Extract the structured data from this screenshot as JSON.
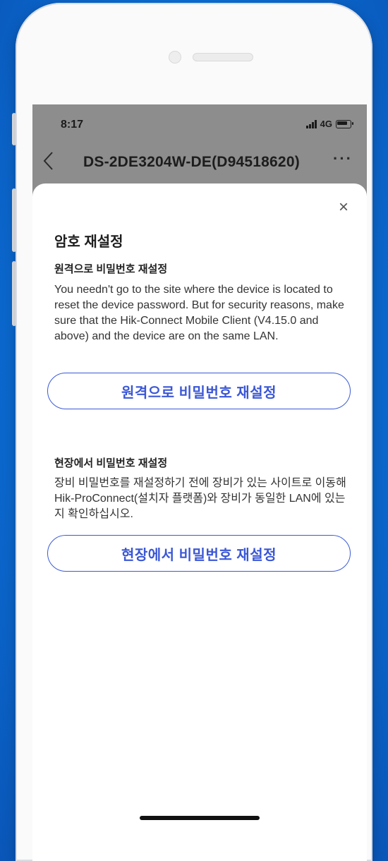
{
  "status_bar": {
    "time": "8:17",
    "network": "4G"
  },
  "nav": {
    "back_icon": "chevron-left-icon",
    "title": "DS-2DE3204W-DE(D94518620)",
    "more_icon": "more-dots-icon",
    "more_glyph": "···"
  },
  "sheet": {
    "close_glyph": "×",
    "title": "암호 재설정",
    "remote": {
      "heading": "원격으로 비밀번호 재설정",
      "description": "You needn't go to the site where the device is located to reset the device password. But for security reasons, make sure that the Hik-Connect Mobile Client (V4.15.0 and above) and the device are on the same LAN.",
      "button_label": "원격으로 비밀번호 재설정"
    },
    "onsite": {
      "heading": "현장에서 비밀번호 재설정",
      "description": "장비 비밀번호를 재설정하기 전에 장비가 있는 사이트로 이동해 Hik-ProConnect(설치자 플랫폼)와 장비가 동일한 LAN에 있는지 확인하십시오.",
      "button_label": "현장에서 비밀번호 재설정"
    }
  },
  "colors": {
    "accent": "#3a57d6",
    "background_blue": "#0b6fd6",
    "topbar_gray": "#8d8d8d"
  }
}
